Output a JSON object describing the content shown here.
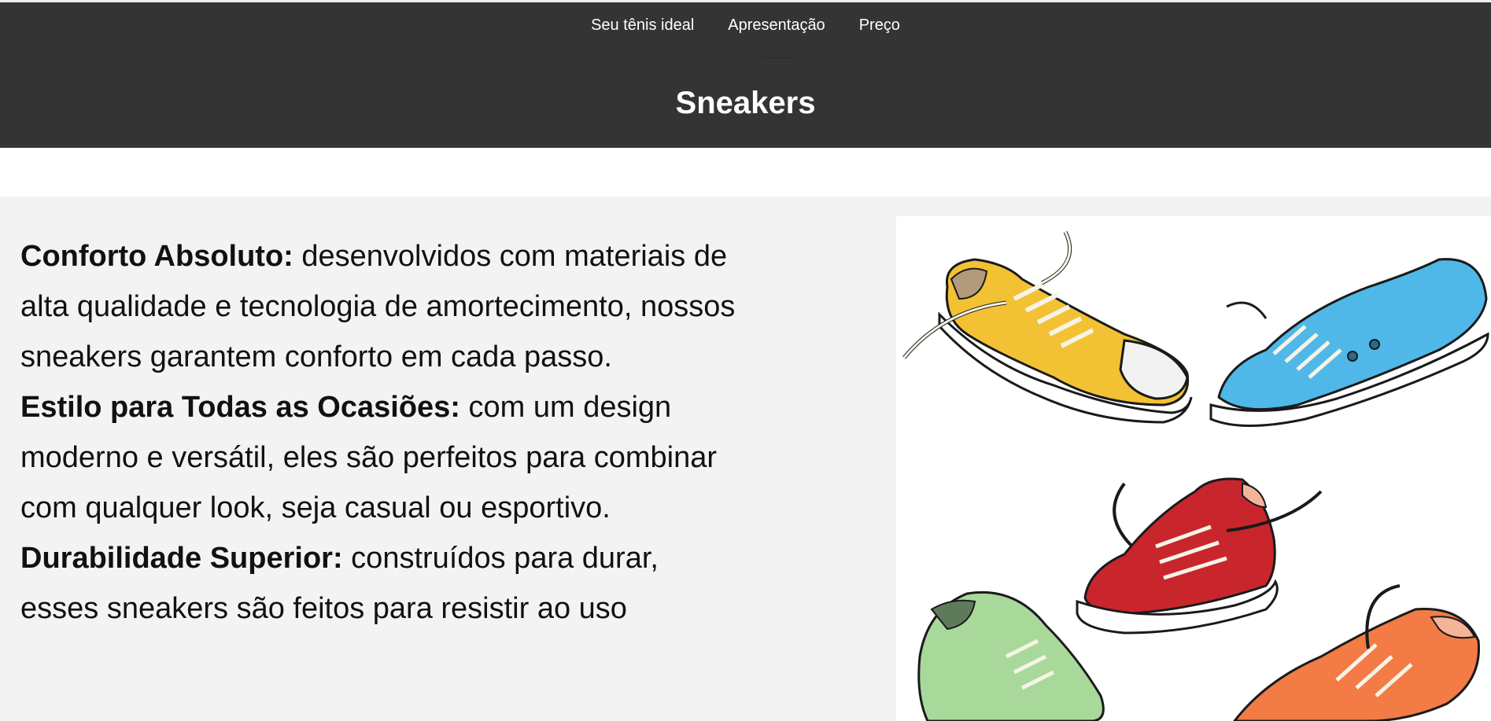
{
  "nav": {
    "items": [
      {
        "label": "Seu tênis ideal"
      },
      {
        "label": "Apresentação"
      },
      {
        "label": "Preço"
      }
    ]
  },
  "header": {
    "title": "Sneakers"
  },
  "features": [
    {
      "title": "Conforto Absoluto:",
      "text": " desenvolvidos com materiais de alta qualidade e tecnologia de amortecimento, nossos sneakers garantem conforto em cada passo."
    },
    {
      "title": "Estilo para Todas as Ocasiões:",
      "text": " com um design moderno e versátil, eles são perfeitos para combinar com qualquer look, seja casual ou esportivo."
    },
    {
      "title": "Durabilidade Superior:",
      "text": " construídos para durar, esses sneakers são feitos para resistir ao uso"
    }
  ],
  "illustration": {
    "icon": "sneakers-illustration",
    "colors": [
      "#f3c234",
      "#4fb8e8",
      "#c8262c",
      "#a8d99b",
      "#f37b45"
    ]
  }
}
